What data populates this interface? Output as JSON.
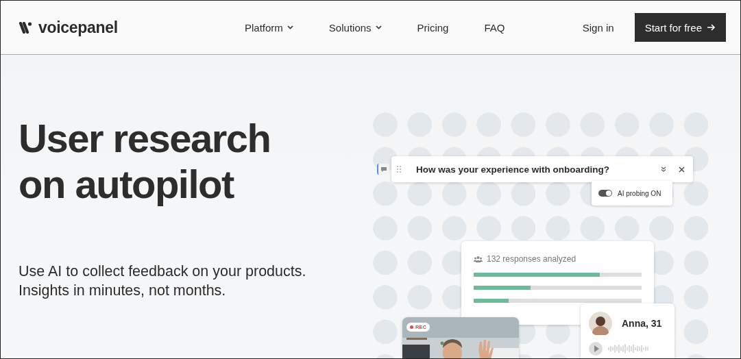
{
  "brand": {
    "name": "voicepanel"
  },
  "nav": [
    {
      "label": "Platform",
      "dropdown": true
    },
    {
      "label": "Solutions",
      "dropdown": true
    },
    {
      "label": "Pricing",
      "dropdown": false
    },
    {
      "label": "FAQ",
      "dropdown": false
    }
  ],
  "sign_in": "Sign in",
  "cta": {
    "label": "Start for free"
  },
  "hero": {
    "headline": [
      "User research",
      "on autopilot"
    ],
    "subtitle": [
      "Use AI to collect feedback on your products.",
      "Insights in minutes, not months."
    ]
  },
  "question_card": {
    "question": "How was your experience with onboarding?"
  },
  "probe": {
    "label": "AI probing ON",
    "on": true
  },
  "responses": {
    "label": "132 responses analyzed",
    "bars": [
      {
        "level": 0.75
      },
      {
        "level": 0.34
      },
      {
        "level": 0.21
      }
    ]
  },
  "video": {
    "badge": "REC",
    "kind": "picture"
  },
  "participant": {
    "name": "Anna, 31"
  }
}
